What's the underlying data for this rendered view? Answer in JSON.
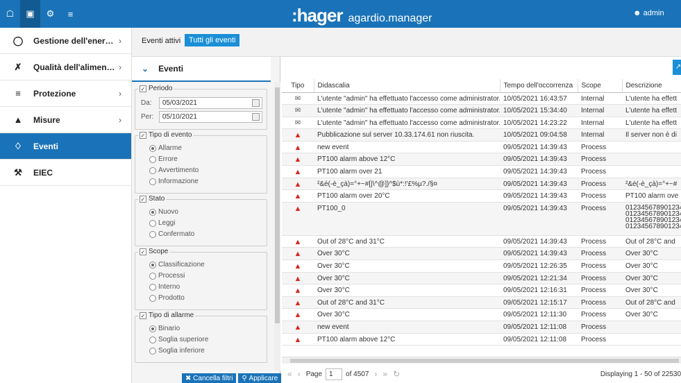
{
  "topbar": {
    "icons": [
      "home-icon",
      "laptop-icon",
      "settings-icon",
      "sliders-icon"
    ],
    "brand": ":hager",
    "product": "agardio.manager",
    "user": "admin"
  },
  "nav": {
    "items": [
      {
        "label": "Gestione dell'ener…",
        "icon": "bulb-icon",
        "chevron": "›"
      },
      {
        "label": "Qualità dell'alimen…",
        "icon": "wrench-icon",
        "chevron": "›"
      },
      {
        "label": "Protezione",
        "icon": "sliders-icon",
        "chevron": "›"
      },
      {
        "label": "Misure",
        "icon": "chart-icon",
        "chevron": "›"
      },
      {
        "label": "Eventi",
        "icon": "bell-icon",
        "chevron": ""
      },
      {
        "label": "EIEC",
        "icon": "network-icon",
        "chevron": ""
      }
    ]
  },
  "subbar": {
    "tab_active": "Eventi attivi",
    "tab_all": "Tutti gli eventi"
  },
  "filters": {
    "header": "Eventi",
    "periodo": {
      "legend": "Periodo",
      "da_label": "Da:",
      "da_value": "05/03/2021",
      "per_label": "Per:",
      "per_value": "05/10/2021"
    },
    "tipo_evento": {
      "legend": "Tipo di evento",
      "options": [
        "Allarme",
        "Errore",
        "Avvertimento",
        "Informazione"
      ]
    },
    "stato": {
      "legend": "Stato",
      "options": [
        "Nuovo",
        "Leggi",
        "Confermato"
      ]
    },
    "scope": {
      "legend": "Scope",
      "options": [
        "Classificazione",
        "Processi",
        "Interno",
        "Prodotto"
      ]
    },
    "tipo_allarme": {
      "legend": "Tipo di allarme",
      "options": [
        "Binario",
        "Soglia superiore",
        "Soglia inferiore"
      ]
    },
    "cancel_label": "Cancella filtri",
    "apply_label": "Applicare"
  },
  "table": {
    "columns": [
      "Tipo",
      "Didascalia",
      "Tempo dell'occorrenza",
      "Scope",
      "Descrizione"
    ],
    "rows": [
      {
        "type": "mail",
        "caption": "L'utente \"admin\" ha effettuato l'accesso come administrator.",
        "time": "10/05/2021 16:43:57",
        "scope": "Internal",
        "desc": "L'utente ha effett"
      },
      {
        "type": "mail",
        "caption": "L'utente \"admin\" ha effettuato l'accesso come administrator.",
        "time": "10/05/2021 15:34:40",
        "scope": "Internal",
        "desc": "L'utente ha effett"
      },
      {
        "type": "mail",
        "caption": "L'utente \"admin\" ha effettuato l'accesso come administrator.",
        "time": "10/05/2021 14:23:22",
        "scope": "Internal",
        "desc": "L'utente ha effett"
      },
      {
        "type": "warn",
        "caption": "Pubblicazione sul server 10.33.174.61 non riuscita.",
        "time": "10/05/2021 09:04:58",
        "scope": "Internal",
        "desc": "Il server non è di"
      },
      {
        "type": "warn",
        "caption": "new event",
        "time": "09/05/2021 14:39:43",
        "scope": "Process",
        "desc": ""
      },
      {
        "type": "warn",
        "caption": "PT100 alarm above 12°C",
        "time": "09/05/2021 14:39:43",
        "scope": "Process",
        "desc": ""
      },
      {
        "type": "warn",
        "caption": "PT100 alarm over 21",
        "time": "09/05/2021 14:39:43",
        "scope": "Process",
        "desc": ""
      },
      {
        "type": "warn",
        "caption": "²&é(-è_çà)=°+~#[|\\^@]}^$ù*:!'£%µ?./§¤",
        "time": "09/05/2021 14:39:43",
        "scope": "Process",
        "desc": "²&é(-è_çà)=°+~#"
      },
      {
        "type": "warn",
        "caption": "PT100 alarm over 20°C",
        "time": "09/05/2021 14:39:43",
        "scope": "Process",
        "desc": "PT100 alarm ove"
      },
      {
        "type": "warn",
        "caption": "PT100_0",
        "time": "09/05/2021 14:39:43",
        "scope": "Process",
        "desc": "012345678901234567890123\n012345678901234567890123\n012345678901234567890123\n012345678901234567890123",
        "tall": true
      },
      {
        "type": "warn",
        "caption": "Out of 28°C and 31°C",
        "time": "09/05/2021 14:39:43",
        "scope": "Process",
        "desc": "Out of 28°C and"
      },
      {
        "type": "warn",
        "caption": "Over 30°C",
        "time": "09/05/2021 14:39:43",
        "scope": "Process",
        "desc": "Over 30°C"
      },
      {
        "type": "warn",
        "caption": "Over 30°C",
        "time": "09/05/2021 12:26:35",
        "scope": "Process",
        "desc": "Over 30°C"
      },
      {
        "type": "warn",
        "caption": "Over 30°C",
        "time": "09/05/2021 12:21:34",
        "scope": "Process",
        "desc": "Over 30°C"
      },
      {
        "type": "warn",
        "caption": "Over 30°C",
        "time": "09/05/2021 12:16:31",
        "scope": "Process",
        "desc": "Over 30°C"
      },
      {
        "type": "warn",
        "caption": "Out of 28°C and 31°C",
        "time": "09/05/2021 12:15:17",
        "scope": "Process",
        "desc": "Out of 28°C and"
      },
      {
        "type": "warn",
        "caption": "Over 30°C",
        "time": "09/05/2021 12:11:30",
        "scope": "Process",
        "desc": "Over 30°C"
      },
      {
        "type": "warn",
        "caption": "new event",
        "time": "09/05/2021 12:11:08",
        "scope": "Process",
        "desc": ""
      },
      {
        "type": "warn",
        "caption": "PT100 alarm above 12°C",
        "time": "09/05/2021 12:11:08",
        "scope": "Process",
        "desc": ""
      }
    ]
  },
  "pager": {
    "page_label": "Page",
    "page_value": "1",
    "of_label": "of 4507",
    "display": "Displaying 1 - 50 of 22530"
  },
  "colors": {
    "primary": "#1a73b8",
    "accent": "#1a8fd6",
    "alarm": "#d9261c"
  }
}
